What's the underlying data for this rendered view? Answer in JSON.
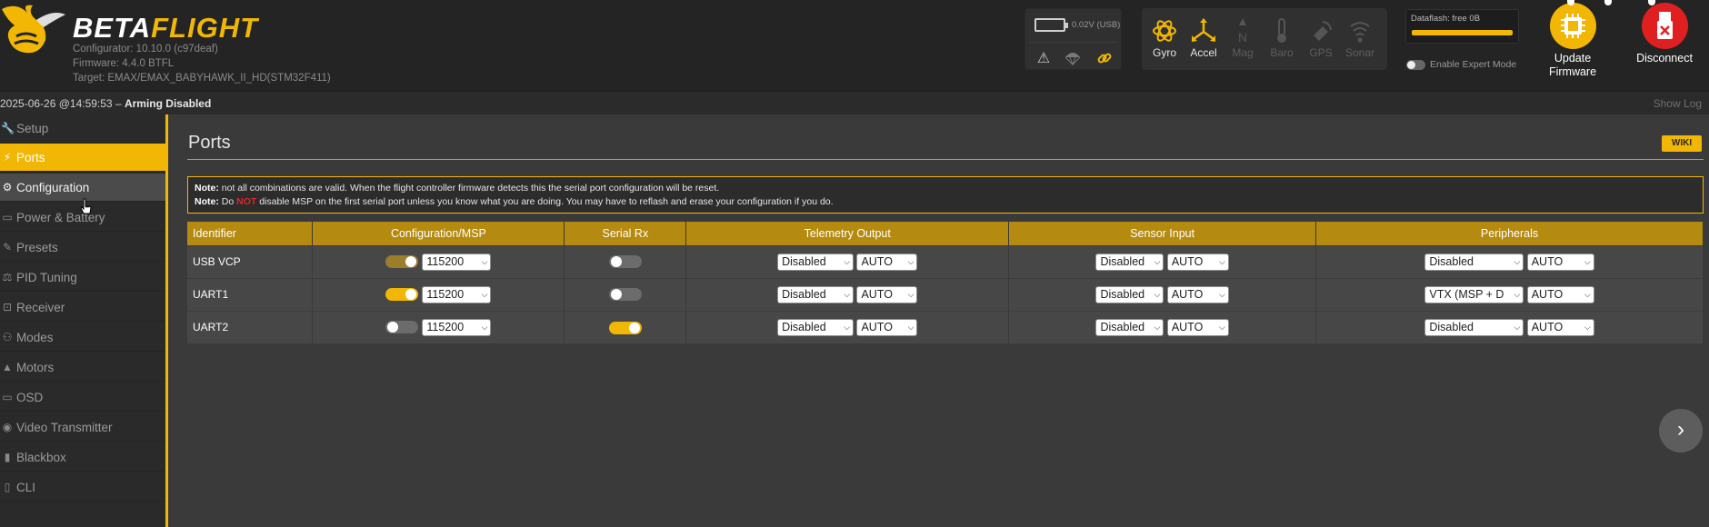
{
  "app": {
    "logo_left": "BETA",
    "logo_right": "FLIGHT",
    "configurator": "Configurator: 10.10.0 (c97deaf)",
    "firmware": "Firmware: 4.4.0 BTFL",
    "target": "Target: EMAX/EMAX_BABYHAWK_II_HD(STM32F411)"
  },
  "battery": {
    "voltage": "0.02V (USB)"
  },
  "sensors": [
    {
      "label": "Gyro",
      "icon": "gyro-icon",
      "active": true
    },
    {
      "label": "Accel",
      "icon": "accel-icon",
      "active": true
    },
    {
      "label": "Mag",
      "icon": "mag-icon",
      "active": false
    },
    {
      "label": "Baro",
      "icon": "baro-icon",
      "active": false
    },
    {
      "label": "GPS",
      "icon": "gps-icon",
      "active": false
    },
    {
      "label": "Sonar",
      "icon": "sonar-icon",
      "active": false
    }
  ],
  "dataflash": {
    "label": "Dataflash: free 0B"
  },
  "expert_mode": {
    "label": "Enable Expert Mode",
    "enabled": false
  },
  "buttons": {
    "update_firmware": "Update Firmware",
    "disconnect": "Disconnect"
  },
  "status": {
    "datetime": "2025-06-26 @14:59:53",
    "separator": " – ",
    "state": "Arming Disabled",
    "show_log": "Show Log"
  },
  "sidebar": {
    "items": [
      {
        "label": "Setup",
        "icon": "wrench-icon"
      },
      {
        "label": "Ports",
        "icon": "plug-icon",
        "active": true
      },
      {
        "label": "Configuration",
        "icon": "gear-icon",
        "hover": true
      },
      {
        "label": "Power & Battery",
        "icon": "battery-icon"
      },
      {
        "label": "Presets",
        "icon": "presets-icon"
      },
      {
        "label": "PID Tuning",
        "icon": "pid-icon"
      },
      {
        "label": "Receiver",
        "icon": "receiver-icon"
      },
      {
        "label": "Modes",
        "icon": "modes-icon"
      },
      {
        "label": "Motors",
        "icon": "motor-icon"
      },
      {
        "label": "OSD",
        "icon": "osd-icon"
      },
      {
        "label": "Video Transmitter",
        "icon": "vtx-icon"
      },
      {
        "label": "Blackbox",
        "icon": "blackbox-icon"
      },
      {
        "label": "CLI",
        "icon": "cli-icon"
      }
    ]
  },
  "page": {
    "title": "Ports",
    "wiki": "WIKI",
    "note1_label": "Note:",
    "note1_text": " not all combinations are valid. When the flight controller firmware detects this the serial port configuration will be reset.",
    "note2_label": "Note:",
    "note2_pre": " Do ",
    "note2_not": "NOT",
    "note2_post": " disable MSP on the first serial port unless you know what you are doing. You may have to reflash and erase your configuration if you do."
  },
  "table": {
    "headers": [
      "Identifier",
      "Configuration/MSP",
      "Serial Rx",
      "Telemetry Output",
      "Sensor Input",
      "Peripherals"
    ],
    "rows": [
      {
        "id": "USB VCP",
        "msp": "dim",
        "baud": "115200",
        "serial_rx": "off",
        "telem": "Disabled",
        "telem_baud": "AUTO",
        "sensor": "Disabled",
        "sensor_baud": "AUTO",
        "periph": "Disabled",
        "periph_baud": "AUTO"
      },
      {
        "id": "UART1",
        "msp": "on",
        "baud": "115200",
        "serial_rx": "off",
        "telem": "Disabled",
        "telem_baud": "AUTO",
        "sensor": "Disabled",
        "sensor_baud": "AUTO",
        "periph": "VTX (MSP + D",
        "periph_baud": "AUTO"
      },
      {
        "id": "UART2",
        "msp": "off",
        "baud": "115200",
        "serial_rx": "on",
        "telem": "Disabled",
        "telem_baud": "AUTO",
        "sensor": "Disabled",
        "sensor_baud": "AUTO",
        "periph": "Disabled",
        "periph_baud": "AUTO"
      }
    ]
  },
  "colors": {
    "accent": "#f2b705",
    "header_bg": "#242424",
    "content_bg": "#3a3a3a",
    "danger": "#e02525"
  }
}
